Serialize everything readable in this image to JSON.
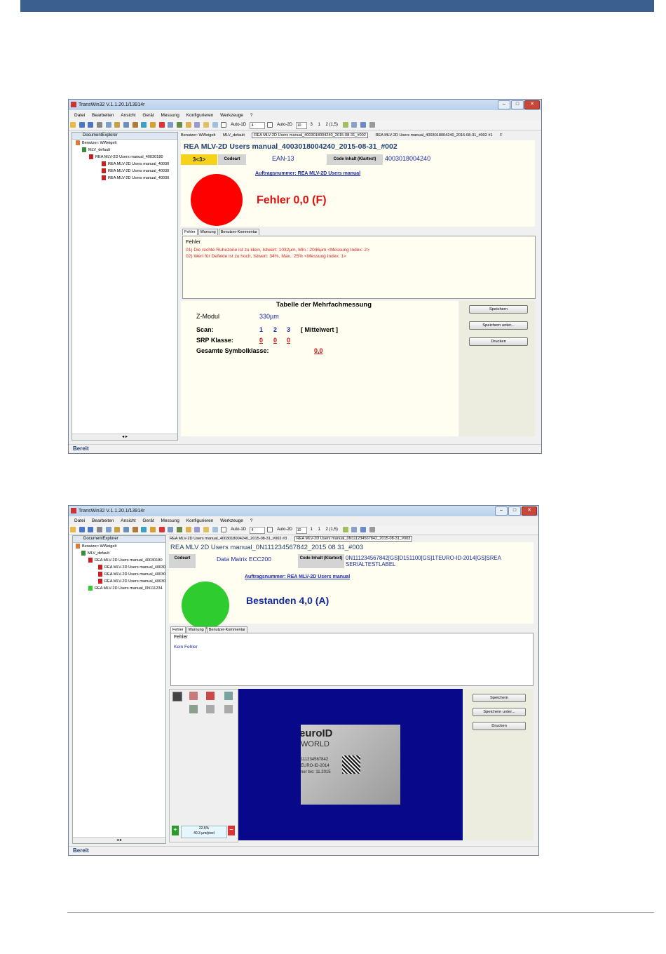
{
  "page": {
    "header_color": "#3b5f8e"
  },
  "window1": {
    "title": "TransWin32 V.1.1.20.1/13914r",
    "menu": [
      "Datei",
      "Bearbeiten",
      "Ansicht",
      "Gerät",
      "Messung",
      "Konfigurieren",
      "Werkzeuge",
      "?"
    ],
    "toolbar": {
      "auto1d": "Auto-1D",
      "auto1d_val": "4",
      "auto2d": "Auto-2D",
      "num1": "10",
      "num2": "3",
      "num3": "1",
      "num4": "2 (1,5)"
    },
    "explorer": {
      "title": "DocumentExplorer",
      "user": "Benutzer: WWeigelt",
      "profile": "MLV_default",
      "items": [
        "REA MLV-2D Users manual_40030180",
        "REA MLV-2D Users manual_40030",
        "REA MLV-2D Users manual_40030",
        "REA MLV-2D Users manual_40030"
      ]
    },
    "tabs": [
      "Benutzer: WWeigelt",
      "MLV_default",
      "REA MLV-2D Users manual_4003018004240_2015-08-31_#002",
      "REA MLV-2D Users manual_4003018004240_2015-08-31_#002 #1",
      "F"
    ],
    "report": {
      "title": "REA MLV-2D Users manual_4003018004240_2015-08-31_#002",
      "grade_box": "3<3>",
      "codeart_label": "Codeart",
      "codeart": "EAN-13",
      "content_label": "Code Inhalt (Klartext)",
      "content": "4003018004240",
      "order": "Auftragsnummer: REA MLV-2D Users manual",
      "result": "Fehler 0,0 (F)",
      "result_color": "#ff0000"
    },
    "subtabs": [
      "Fehler",
      "Warnung",
      "Benutzer-Kommentar"
    ],
    "errors": {
      "header": "Fehler",
      "lines": [
        "01) Die rechte Ruhezone ist zu klein, Istwert: 1032µm, Min.: 2046µm <Messung Index: 2>",
        "02) Wert für Defekte ist zu hoch, Istwert: 34%, Max.: 25% <Messung Index: 1>"
      ]
    },
    "multi": {
      "title": "Tabelle der Mehrfachmessung",
      "zmodul_label": "Z-Modul",
      "zmodul": "330µm",
      "scan_label": "Scan:",
      "scans": [
        "1",
        "2",
        "3"
      ],
      "mittelwert": "[ Mittelwert ]",
      "srp_label": "SRP Klasse:",
      "srp": [
        "0",
        "0",
        "0"
      ],
      "gesamt_label": "Gesamte Symbolklasse:",
      "gesamt": "0,0"
    },
    "buttons": [
      "Speichern",
      "Speichern unter...",
      "Drucken"
    ],
    "status": "Bereit"
  },
  "window2": {
    "title": "TransWin32 V.1.1.20.1/13914r",
    "menu": [
      "Datei",
      "Bearbeiten",
      "Ansicht",
      "Gerät",
      "Messung",
      "Konfigurieren",
      "Werkzeuge",
      "?"
    ],
    "toolbar": {
      "auto1d": "Auto-1D",
      "auto1d_val": "4",
      "auto2d": "Auto-2D",
      "num1": "10",
      "num2": "1",
      "num3": "1",
      "num4": "2 (1,5)"
    },
    "explorer": {
      "title": "DocumentExplorer",
      "user": "Benutzer: WWeigelt",
      "profile": "MLV_default",
      "items": [
        "REA MLV-2D Users manual_40030180",
        "REA MLV-2D Users manual_40030",
        "REA MLV-2D Users manual_40030",
        "REA MLV-2D Users manual_40030",
        "REA MLV-2D Users manual_0N111234"
      ]
    },
    "tabs": [
      "REA MLV-2D Users manual_4003018004240_2015-08-31_#002 #3",
      "REA MLV-2D Users manual_0N111234567842_2015-08-31_#003"
    ],
    "report": {
      "title": "REA MLV 2D Users manual_0N111234567842_2015 08 31_#003",
      "codeart_label": "Codeart",
      "codeart": "Data Matrix ECC200",
      "content_label": "Code Inhalt (Klartext)",
      "content": "0N111234567842[GS]D151100[GS]1TEURO-ID-2014[GS]SREA SERIALTESTLABEL",
      "order": "Auftragsnummer: REA MLV-2D Users manual",
      "result": "Bestanden 4,0 (A)",
      "result_color": "#2ecc2e"
    },
    "subtabs": [
      "Fehler",
      "Warnung",
      "Benutzer-Kommentar"
    ],
    "errors": {
      "header": "Fehler",
      "lines": [
        "Kein Fehler"
      ]
    },
    "image": {
      "logo": "euroID",
      "world": "WORLD",
      "text1": "111234567842",
      "text2": "EURO-ID-2014",
      "text3": "ner bis: 11.2015"
    },
    "zoom": {
      "value": "22.5%",
      "scale": "40.3 µm/pixel"
    },
    "buttons": [
      "Speichern",
      "Speichern unter...",
      "Drucken"
    ],
    "status": "Bereit"
  }
}
